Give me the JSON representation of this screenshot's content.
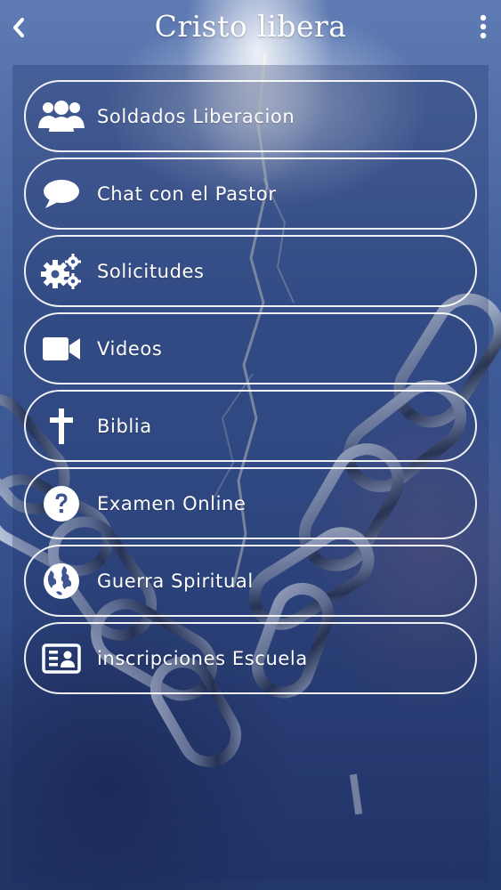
{
  "header": {
    "title": "Cristo libera",
    "back_icon": "chevron-left-icon",
    "menu_icon": "more-vertical-icon"
  },
  "menu": {
    "items": [
      {
        "label": "Soldados Liberacion",
        "icon": "users-icon"
      },
      {
        "label": "Chat con el Pastor",
        "icon": "chat-bubble-icon"
      },
      {
        "label": "Solicitudes",
        "icon": "gears-icon"
      },
      {
        "label": "Videos",
        "icon": "video-camera-icon"
      },
      {
        "label": "Biblia",
        "icon": "cross-icon"
      },
      {
        "label": "Examen Online",
        "icon": "question-circle-icon"
      },
      {
        "label": "Guerra Spiritual",
        "icon": "globe-icon"
      },
      {
        "label": "inscripciones Escuela",
        "icon": "id-card-icon"
      }
    ]
  },
  "colors": {
    "text": "#ffffff",
    "button_border": "#ffffff",
    "background_top": "#5f7bb3",
    "background_bottom": "#22376a"
  }
}
